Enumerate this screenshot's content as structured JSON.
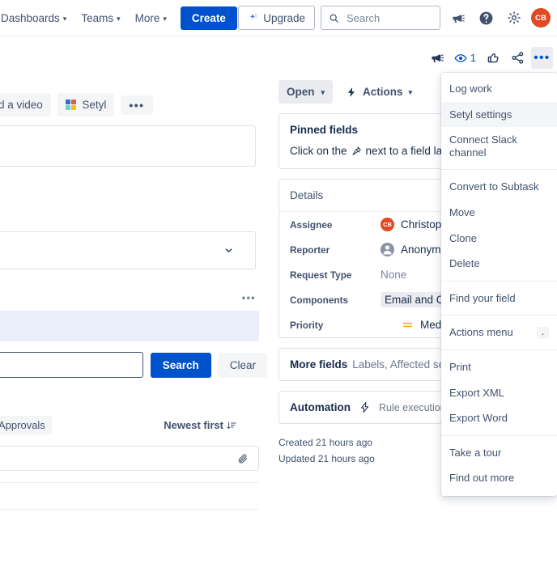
{
  "topnav": {
    "items": [
      {
        "label": "Dashboards",
        "has_caret": true
      },
      {
        "label": "Teams",
        "has_caret": true
      },
      {
        "label": "More",
        "has_caret": true
      }
    ],
    "create_label": "Create",
    "upgrade_label": "Upgrade",
    "search_placeholder": "Search",
    "search_value": "",
    "notifications_icon": "megaphone-icon",
    "help_icon": "help-icon",
    "settings_icon": "gear-icon",
    "avatar_initials": "CB",
    "avatar_color": "#de4a23"
  },
  "left": {
    "record_video_label": "Record a video",
    "setyl_label": "Setyl",
    "setyl_icon_colors": [
      "#2f6fd0",
      "#e05b4b",
      "#6fd0c8",
      "#f0c020"
    ],
    "more_label": "•••",
    "search_placeholder": "",
    "search_value": "",
    "search_button": "Search",
    "clear_button": "Clear",
    "approvals_chip": "Approvals",
    "sort_label": "Newest first",
    "sort_icon": "sort-descending-icon",
    "attachment_icon": "paperclip-icon",
    "comment_value": ""
  },
  "detail": {
    "icons": [
      {
        "name": "megaphone-icon",
        "label": ""
      },
      {
        "name": "watch-eye-icon",
        "label": "1"
      },
      {
        "name": "thumbs-up-icon",
        "label": ""
      },
      {
        "name": "share-icon",
        "label": ""
      },
      {
        "name": "more-actions-icon",
        "label": "•••"
      }
    ],
    "status_label": "Open",
    "actions_label": "Actions",
    "pinned": {
      "title": "Pinned fields",
      "description_before": "Click on the",
      "pin_icon": "pin-icon",
      "description_after": "next to a field label to sta"
    },
    "details_header": "Details",
    "fields": [
      {
        "label": "Assignee",
        "value": "Christopl",
        "avatar": "CB",
        "avatar_color": "#de4a23",
        "type": "avatar"
      },
      {
        "label": "Reporter",
        "value": "Anonymo",
        "avatar": "",
        "avatar_color": "#8993a4",
        "type": "anon"
      },
      {
        "label": "Request Type",
        "value": "None",
        "type": "muted"
      },
      {
        "label": "Components",
        "value": "Email and Coll",
        "type": "chip"
      },
      {
        "label": "Priority",
        "value": "Medium",
        "type": "priority",
        "priority_color": "#f5a623"
      }
    ],
    "more_fields_title": "More fields",
    "more_fields_list": "Labels, Affected services, Urgen",
    "automation_title": "Automation",
    "automation_icon": "automation-bolt-icon",
    "automation_sub": "Rule executions",
    "created_text": "Created 21 hours ago",
    "updated_text": "Updated 21 hours ago"
  },
  "menu": {
    "groups": [
      {
        "items": [
          {
            "label": "Log work",
            "selected": false
          },
          {
            "label": "Setyl settings",
            "selected": true
          },
          {
            "label": "Connect Slack channel",
            "selected": false
          }
        ]
      },
      {
        "items": [
          {
            "label": "Convert to Subtask",
            "selected": false
          },
          {
            "label": "Move",
            "selected": false
          },
          {
            "label": "Clone",
            "selected": false
          },
          {
            "label": "Delete",
            "selected": false
          }
        ]
      },
      {
        "items": [
          {
            "label": "Find your field",
            "selected": false
          }
        ]
      },
      {
        "items": [
          {
            "label": "Actions menu",
            "selected": false,
            "shortcut": "."
          }
        ]
      },
      {
        "items": [
          {
            "label": "Print",
            "selected": false
          },
          {
            "label": "Export XML",
            "selected": false
          },
          {
            "label": "Export Word",
            "selected": false
          }
        ]
      },
      {
        "items": [
          {
            "label": "Take a tour",
            "selected": false
          },
          {
            "label": "Find out more",
            "selected": false
          }
        ]
      }
    ]
  }
}
